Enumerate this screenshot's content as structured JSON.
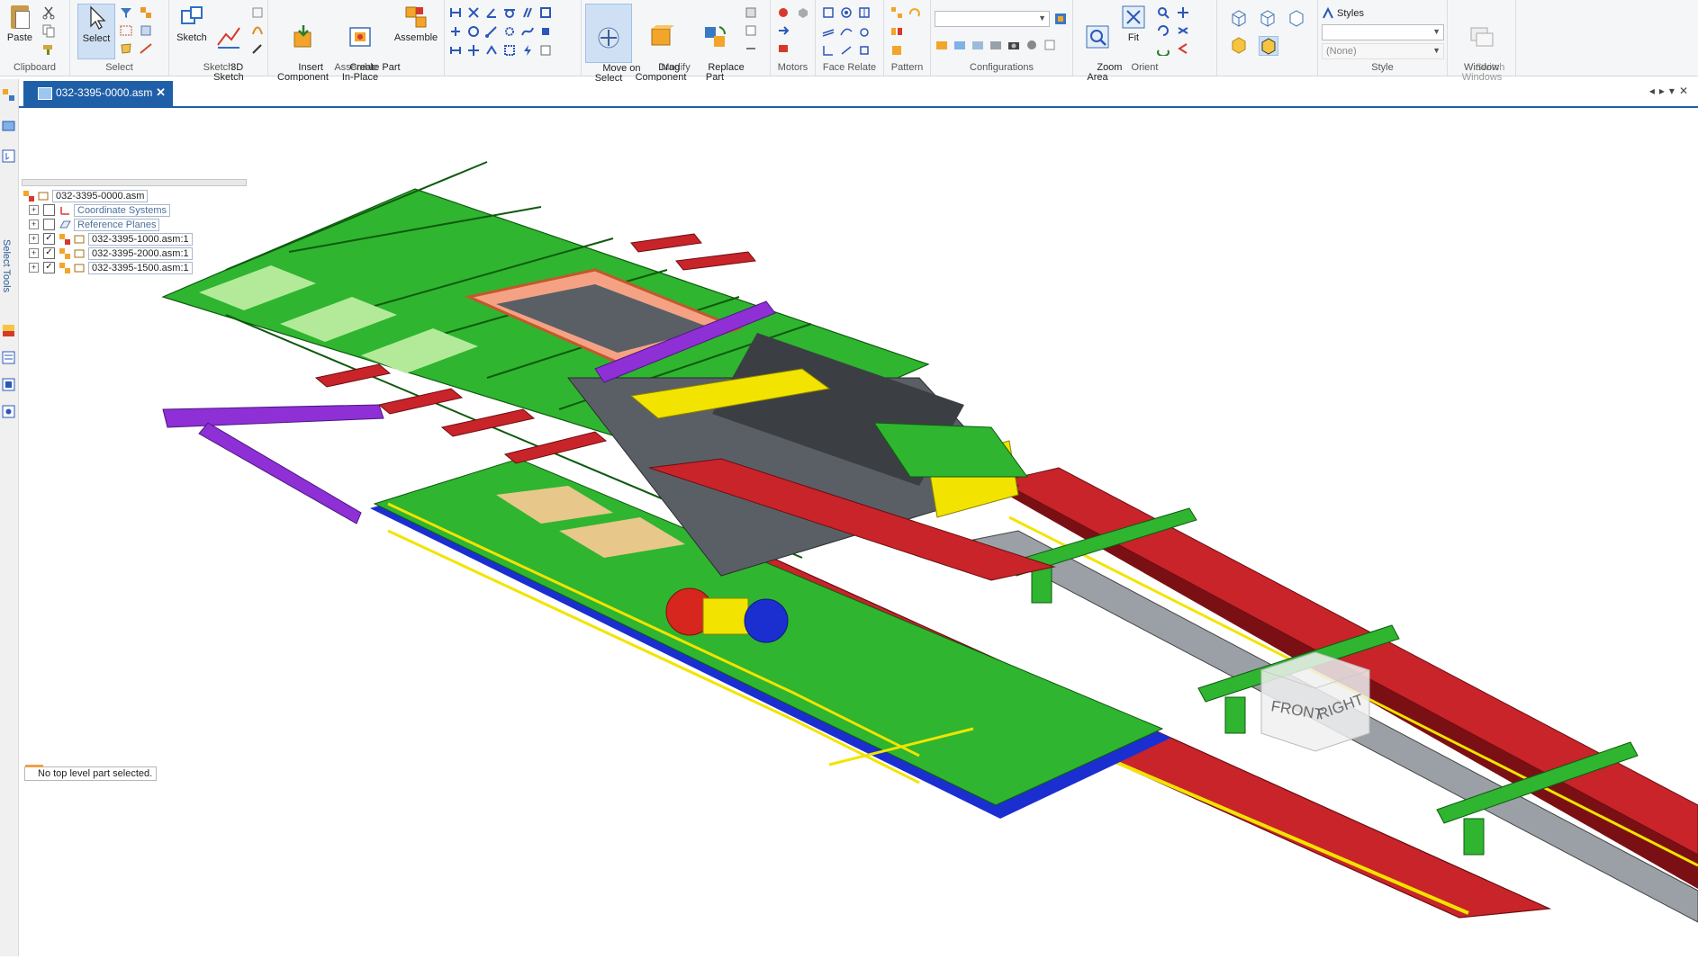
{
  "ribbon": {
    "groups": [
      {
        "label": "Clipboard",
        "buttons": [
          "Paste"
        ]
      },
      {
        "label": "Select",
        "buttons": [
          "Select"
        ]
      },
      {
        "label": "Sketch",
        "buttons": [
          "Sketch",
          "3D\nSketch"
        ]
      },
      {
        "label": "Assemble",
        "buttons": [
          "Insert\nComponent",
          "Create Part\nIn-Place",
          "Assemble"
        ]
      },
      {
        "label": "Modify",
        "buttons": [
          "Move on\nSelect",
          "Drag\nComponent",
          "Replace\nPart"
        ]
      },
      {
        "label": "Motors"
      },
      {
        "label": "Face Relate"
      },
      {
        "label": "Pattern"
      },
      {
        "label": "Configurations"
      },
      {
        "label": "Orient",
        "buttons": [
          "Zoom\nArea",
          "Fit"
        ]
      },
      {
        "label": "Style"
      },
      {
        "label": "Window",
        "buttons": [
          "Switch\nWindows"
        ]
      }
    ],
    "styles_label": "Styles",
    "style_none": "(None)"
  },
  "document_tab": {
    "title": "032-3395-0000.asm"
  },
  "sidebar": {
    "label": "Select Tools"
  },
  "tree": {
    "root": "032-3395-0000.asm",
    "items": [
      {
        "label": "Coordinate Systems",
        "checked": false
      },
      {
        "label": "Reference Planes",
        "checked": false
      },
      {
        "label": "032-3395-1000.asm:1",
        "checked": true
      },
      {
        "label": "032-3395-2000.asm:1",
        "checked": true
      },
      {
        "label": "032-3395-1500.asm:1",
        "checked": true
      }
    ]
  },
  "status": "No top level part selected.",
  "view_cube": {
    "front": "FRONT",
    "right": "RIGHT"
  },
  "colors": {
    "accent": "#1f5fa8",
    "frame_green": "#2fb52f",
    "rail_red": "#c8242a",
    "beam_purple": "#8f2fd6",
    "base_blue": "#1b2fd0",
    "handrail_yellow": "#f2e400",
    "liner_gray": "#5a5f66"
  }
}
